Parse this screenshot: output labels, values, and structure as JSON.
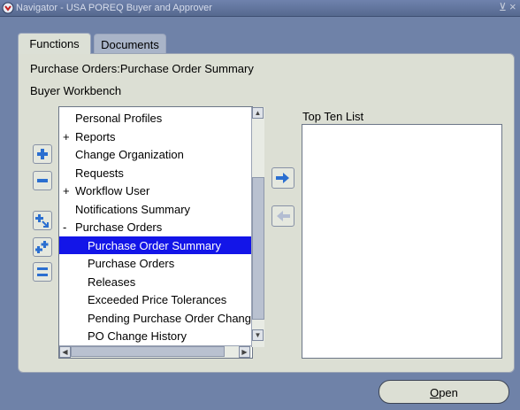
{
  "window": {
    "title": "Navigator - USA POREQ Buyer and Approver",
    "minimize_glyph": "⊻",
    "close_glyph": "×"
  },
  "tabs": [
    {
      "label": "Functions",
      "active": true
    },
    {
      "label": "Documents",
      "active": false
    }
  ],
  "main": {
    "heading": "Purchase Orders:Purchase Order Summary",
    "subheading": "Buyer Workbench"
  },
  "function_list": {
    "items": [
      {
        "label": "Personal Profiles",
        "prefix": "",
        "indent": 0,
        "selected": false
      },
      {
        "label": "Reports",
        "prefix": "+",
        "indent": 0,
        "selected": false
      },
      {
        "label": "Change Organization",
        "prefix": "",
        "indent": 0,
        "selected": false
      },
      {
        "label": "Requests",
        "prefix": "",
        "indent": 0,
        "selected": false
      },
      {
        "label": "Workflow User",
        "prefix": "+",
        "indent": 0,
        "selected": false
      },
      {
        "label": "Notifications Summary",
        "prefix": "",
        "indent": 0,
        "selected": false
      },
      {
        "label": "Purchase Orders",
        "prefix": "-",
        "indent": 0,
        "selected": false
      },
      {
        "label": "Purchase Order Summary",
        "prefix": "",
        "indent": 1,
        "selected": true
      },
      {
        "label": "Purchase Orders",
        "prefix": "",
        "indent": 1,
        "selected": false
      },
      {
        "label": "Releases",
        "prefix": "",
        "indent": 1,
        "selected": false
      },
      {
        "label": "Exceeded Price Tolerances",
        "prefix": "",
        "indent": 1,
        "selected": false
      },
      {
        "label": "Pending Purchase Order Chang",
        "prefix": "",
        "indent": 1,
        "selected": false
      },
      {
        "label": "PO Change History",
        "prefix": "",
        "indent": 1,
        "selected": false
      }
    ]
  },
  "top_ten": {
    "label": "Top Ten List"
  },
  "buttons": {
    "open_label_prefix": "O",
    "open_label_rest": "pen"
  },
  "icons": {
    "expand": "plus-icon",
    "collapse": "minus-icon",
    "expand_branch": "expand-branch-icon",
    "expand_all": "expand-all-icon",
    "collapse_all": "collapse-all-icon",
    "add_to_list": "arrow-right-icon",
    "remove_from_list": "arrow-left-icon",
    "accent": "#1315e8"
  }
}
